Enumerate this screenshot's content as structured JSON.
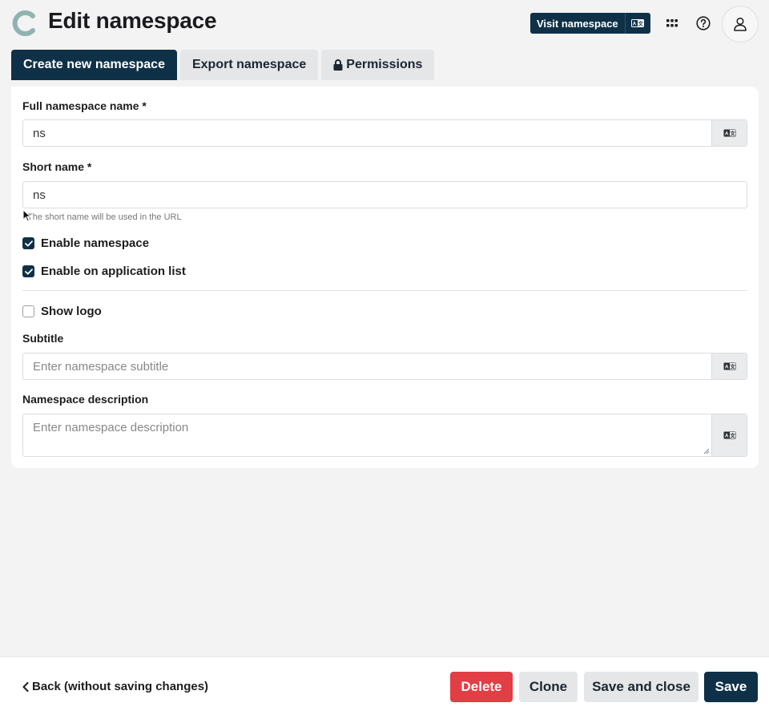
{
  "header": {
    "title": "Edit namespace",
    "visit_label": "Visit namespace",
    "icons": [
      "logo-c-icon",
      "translate-icon",
      "grid-icon",
      "help-icon",
      "user-icon"
    ]
  },
  "tabs": [
    {
      "label": "Create new namespace",
      "active": true
    },
    {
      "label": "Export namespace",
      "active": false
    },
    {
      "label": "Permissions",
      "active": false,
      "icon": "lock-icon"
    }
  ],
  "form": {
    "full_name": {
      "label": "Full namespace name *",
      "value": "ns"
    },
    "short_name": {
      "label": "Short name *",
      "value": "ns",
      "hint": "The short name will be used in the URL"
    },
    "enable_namespace": {
      "label": "Enable namespace",
      "checked": true
    },
    "enable_app_list": {
      "label": "Enable on application list",
      "checked": true
    },
    "show_logo": {
      "label": "Show logo",
      "checked": false
    },
    "subtitle": {
      "label": "Subtitle",
      "placeholder": "Enter namespace subtitle",
      "value": ""
    },
    "description": {
      "label": "Namespace description",
      "placeholder": "Enter namespace description",
      "value": ""
    }
  },
  "footer": {
    "back_label": "Back (without saving changes)",
    "delete_label": "Delete",
    "clone_label": "Clone",
    "save_close_label": "Save and close",
    "save_label": "Save"
  },
  "colors": {
    "primary": "#0f3148",
    "danger": "#e23e45",
    "secondary": "#e4e6e8",
    "logo": "#8fb3b0"
  }
}
